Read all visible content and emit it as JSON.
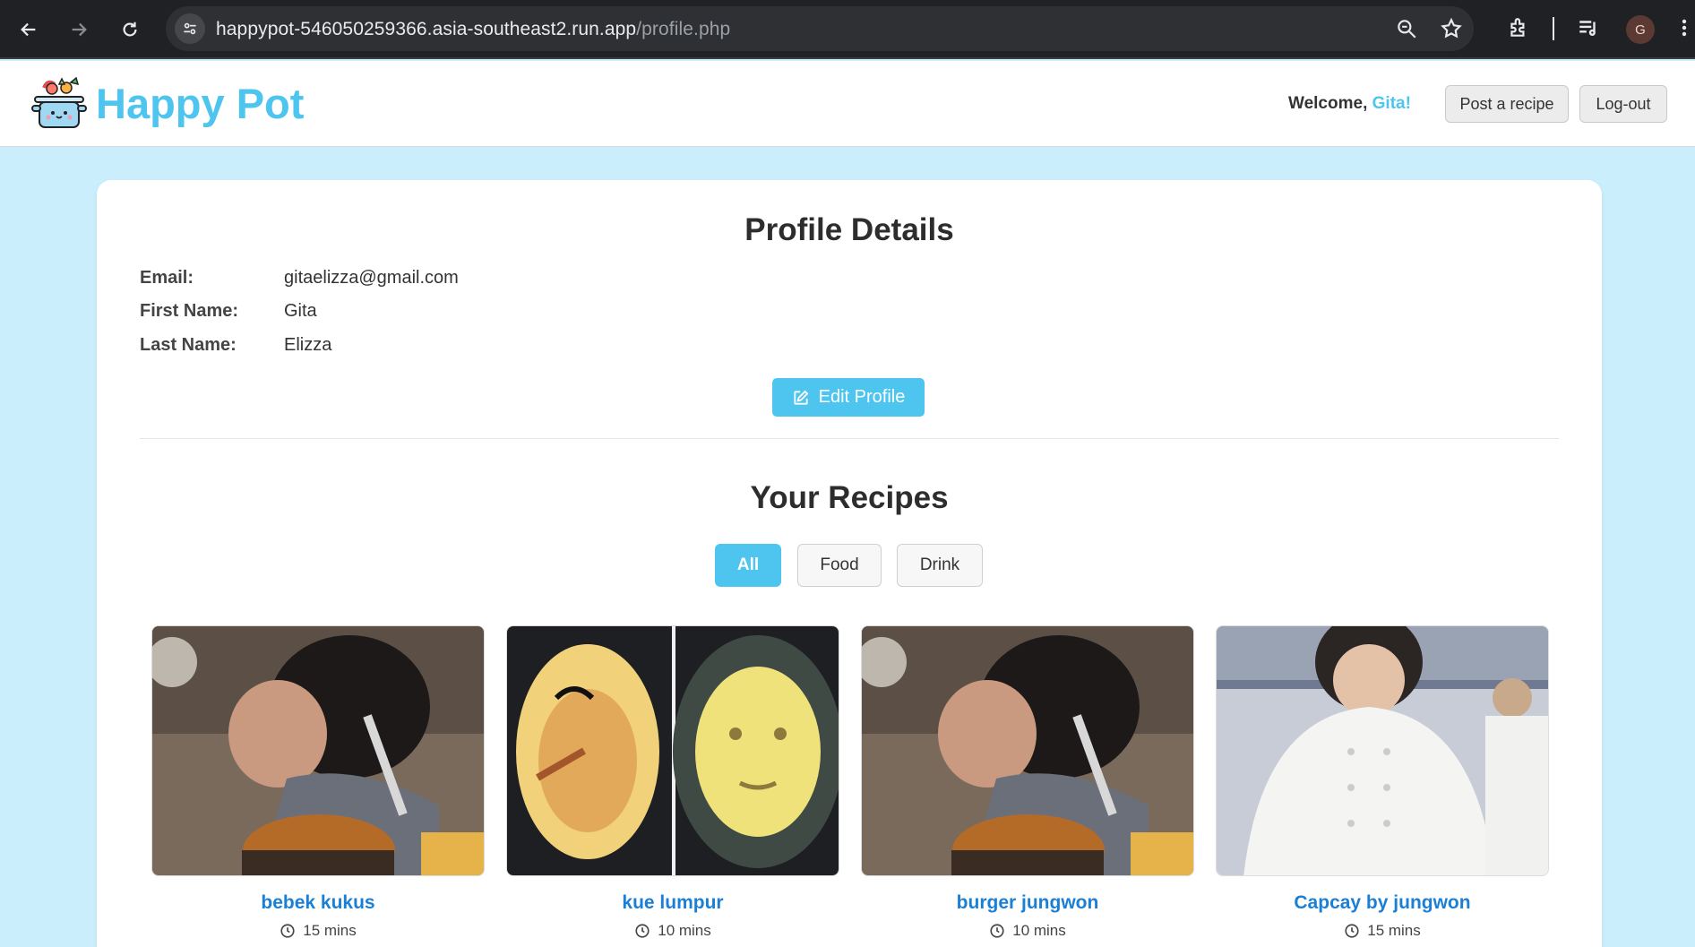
{
  "browser": {
    "url_host": "happypot-546050259366.asia-southeast2.run.app",
    "url_path": "/profile.php",
    "avatar_letter": "G"
  },
  "header": {
    "brand": "Happy Pot",
    "welcome_prefix": "Welcome, ",
    "welcome_name": "Gita!",
    "post_recipe": "Post a recipe",
    "logout": "Log-out"
  },
  "profile": {
    "title": "Profile Details",
    "email_label": "Email:",
    "email": "gitaelizza@gmail.com",
    "first_name_label": "First Name:",
    "first_name": "Gita",
    "last_name_label": "Last Name:",
    "last_name": "Elizza",
    "edit_button": "Edit Profile"
  },
  "recipes": {
    "title": "Your Recipes",
    "filters": [
      {
        "label": "All",
        "active": true
      },
      {
        "label": "Food",
        "active": false
      },
      {
        "label": "Drink",
        "active": false
      }
    ],
    "items": [
      {
        "title": "bebek kukus",
        "time": "15 mins"
      },
      {
        "title": "kue lumpur",
        "time": "10 mins"
      },
      {
        "title": "burger jungwon",
        "time": "10 mins"
      },
      {
        "title": "Capcay by jungwon",
        "time": "15 mins"
      }
    ]
  },
  "colors": {
    "accent": "#4ec5ef",
    "page_bg": "#caeefb",
    "recipe_title": "#1b7fd6"
  }
}
